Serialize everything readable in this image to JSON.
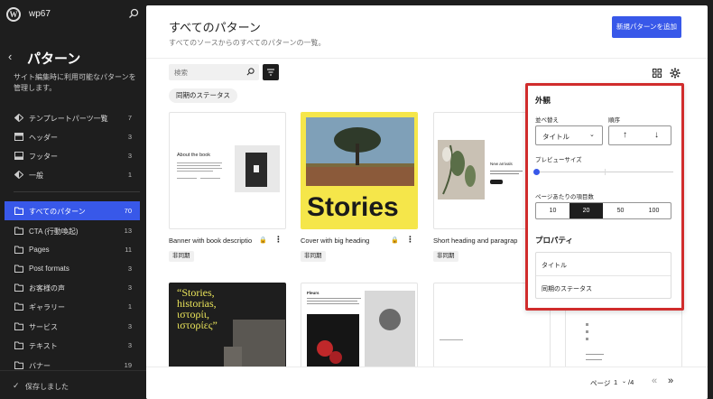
{
  "site": {
    "name": "wp67"
  },
  "sidebar": {
    "title": "パターン",
    "description": "サイト編集時に利用可能なパターンを管理します。",
    "items": [
      {
        "label": "テンプレートパーツ一覧",
        "count": "7"
      },
      {
        "label": "ヘッダー",
        "count": "3"
      },
      {
        "label": "フッター",
        "count": "3"
      },
      {
        "label": "一般",
        "count": "1"
      }
    ],
    "categories": [
      {
        "label": "すべてのパターン",
        "count": "70"
      },
      {
        "label": "CTA (行動喚起)",
        "count": "13"
      },
      {
        "label": "Pages",
        "count": "11"
      },
      {
        "label": "Post formats",
        "count": "3"
      },
      {
        "label": "お客様の声",
        "count": "3"
      },
      {
        "label": "ギャラリー",
        "count": "1"
      },
      {
        "label": "サービス",
        "count": "3"
      },
      {
        "label": "テキスト",
        "count": "3"
      },
      {
        "label": "バナー",
        "count": "19"
      }
    ],
    "saved_label": "保存しました"
  },
  "header": {
    "title": "すべてのパターン",
    "subtitle": "すべてのソースからのすべてのパターンの一覧。",
    "add_button": "新規パターンを追加"
  },
  "toolbar": {
    "search_placeholder": "検索",
    "filter_chip": "同期のステータス"
  },
  "patterns": [
    {
      "title": "Banner with book descriptio",
      "badge": "非同期",
      "preview_heading": "About the book"
    },
    {
      "title": "Cover with big heading",
      "badge": "非同期",
      "preview_text": "Stories"
    },
    {
      "title": "Short heading and paragrap",
      "badge": "非同期",
      "preview_text": "New arrivals"
    },
    {
      "title": "",
      "badge": "",
      "preview_text": "“Stories, historias, ιστορίι, ιστορίες”"
    },
    {
      "title": "",
      "badge": "",
      "preview_text": "Fleurs"
    },
    {
      "title": "",
      "badge": ""
    },
    {
      "title": "",
      "badge": ""
    }
  ],
  "pagination": {
    "page_label": "ページ",
    "current": "1",
    "total": "/4",
    "first": "«",
    "last": "»"
  },
  "view_options": {
    "appearance_heading": "外観",
    "sort_label": "並べ替え",
    "sort_value": "タイトル",
    "order_label": "順序",
    "order_asc": "↑",
    "order_desc": "↓",
    "preview_size_label": "プレビューサイズ",
    "preview_size_value": 0,
    "per_page_label": "ページあたりの項目数",
    "per_page_options": [
      "10",
      "20",
      "50",
      "100"
    ],
    "per_page_selected": "20",
    "properties_heading": "プロパティ",
    "properties": [
      "タイトル",
      "同期のステータス"
    ]
  },
  "colors": {
    "accent": "#3858e9",
    "highlight_border": "#d02c2c",
    "cover_yellow": "#f5e64a"
  }
}
